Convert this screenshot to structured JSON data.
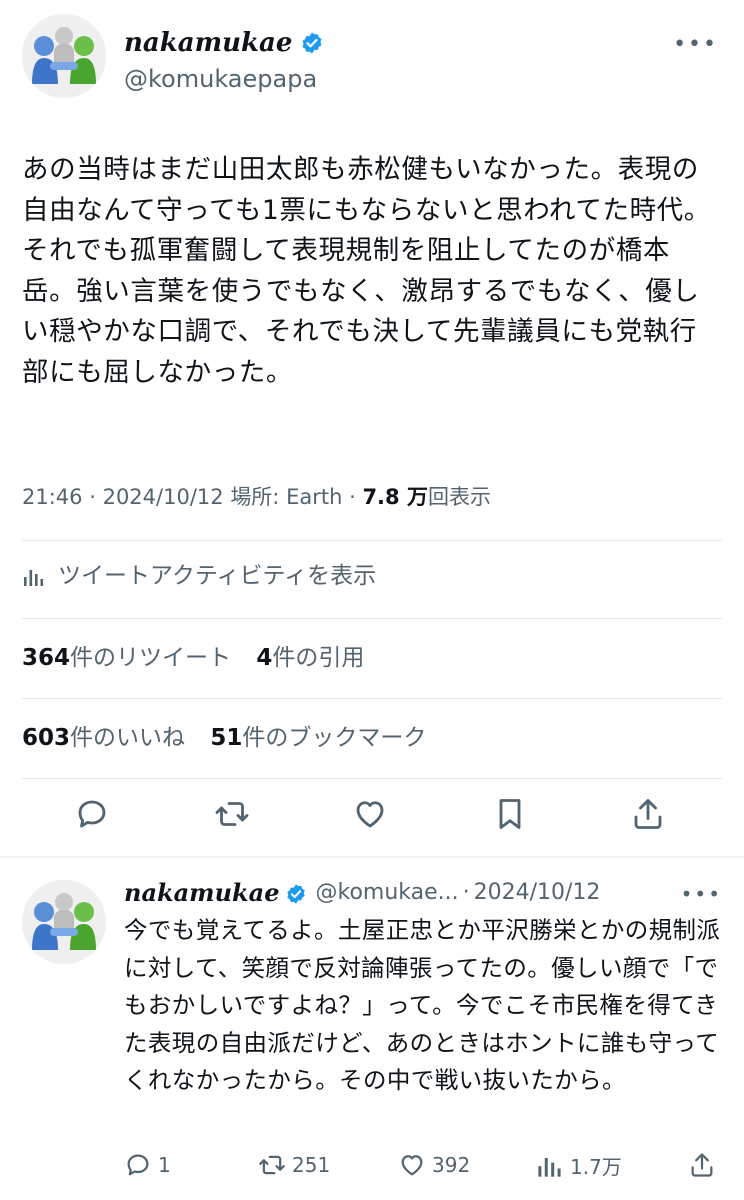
{
  "main_tweet": {
    "display_name": "nakamukae",
    "handle": "@komukaepapa",
    "more_icon": "more-horizontal-icon",
    "text": "あの当時はまだ山田太郎も赤松健もいなかった。表現の自由なんて守っても1票にもならないと思われてた時代。それでも孤軍奮闘して表現規制を阻止してたのが橋本岳。強い言葉を使うでもなく、激昂するでもなく、優しい穏やかな口調で、それでも決して先輩議員にも党執行部にも屈しなかった。",
    "time": "21:46",
    "date": "2024/10/12",
    "location_label": "場所: Earth",
    "views_count": "7.8 万",
    "views_label": "回表示",
    "activity_label": "ツイートアクティビティを表示",
    "retweets_count": "364",
    "retweets_label": "件のリツイート",
    "quotes_count": "4",
    "quotes_label": "件の引用",
    "likes_count": "603",
    "likes_label": "件のいいね",
    "bookmarks_count": "51",
    "bookmarks_label": "件のブックマーク"
  },
  "reply": {
    "display_name": "nakamukae",
    "handle_truncated": "@komukae...",
    "separator": "·",
    "date": "2024/10/12",
    "text": "今でも覚えてるよ。土屋正忠とか平沢勝栄とかの規制派に対して、笑顔で反対論陣張ってたの。優しい顔で「でもおかしいですよね？」って。今でこそ市民権を得てきた表現の自由派だけど、あのときはホントに誰も守ってくれなかったから。その中で戦い抜いたから。",
    "replies": "1",
    "retweets": "251",
    "likes": "392",
    "views": "1.7万"
  },
  "colors": {
    "verified": "#1d9bf0",
    "text": "#0f1419",
    "muted": "#536471",
    "divider": "#e5e8eb"
  }
}
